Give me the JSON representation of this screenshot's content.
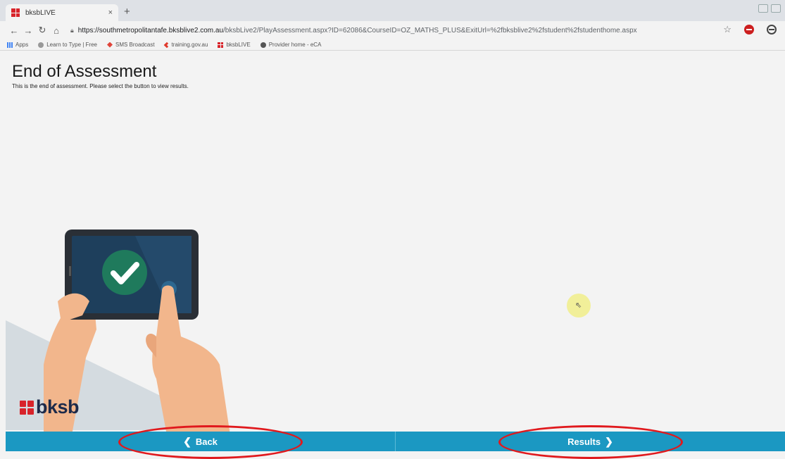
{
  "browser": {
    "tab_title": "bksbLIVE",
    "tab_close": "×",
    "new_tab": "+",
    "url_host": "https://southmetropolitantafe.bksblive2.com.au",
    "url_path": "/bksbLive2/PlayAssessment.aspx?ID=62086&CourseID=OZ_MATHS_PLUS&ExitUrl=%2fbksblive2%2fstudent%2fstudenthome.aspx",
    "bookmarks": [
      "Apps",
      "Learn to Type | Free",
      "SMS Broadcast",
      "training.gov.au",
      "bksbLIVE",
      "Provider home - eCA"
    ]
  },
  "page": {
    "title": "End of Assessment",
    "subtitle": "This is the end of assessment. Please select the button to view results."
  },
  "logo": {
    "text": "bksb"
  },
  "nav": {
    "back_label": "Back",
    "results_label": "Results"
  },
  "colors": {
    "bar": "#1b98c2",
    "check": "#1f7a5c",
    "accent_red": "#d8232a",
    "annotation": "#e0191d"
  },
  "icons": [
    "back-chevron-icon",
    "forward-chevron-icon",
    "checkmark-icon",
    "star-icon",
    "lock-icon"
  ]
}
